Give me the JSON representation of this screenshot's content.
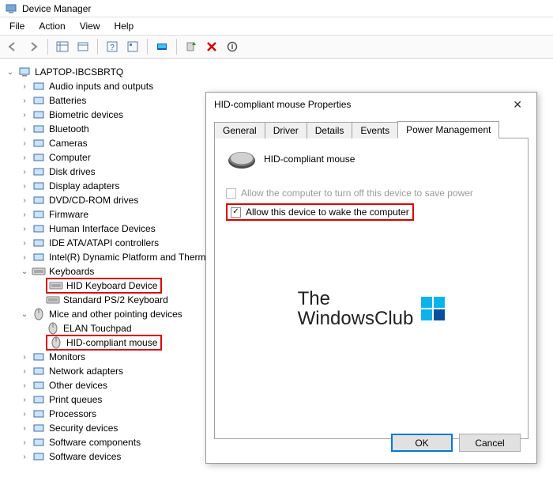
{
  "window": {
    "title": "Device Manager"
  },
  "menu": {
    "file": "File",
    "action": "Action",
    "view": "View",
    "help": "Help"
  },
  "tree": {
    "root": "LAPTOP-IBCSBRTQ",
    "items": [
      "Audio inputs and outputs",
      "Batteries",
      "Biometric devices",
      "Bluetooth",
      "Cameras",
      "Computer",
      "Disk drives",
      "Display adapters",
      "DVD/CD-ROM drives",
      "Firmware",
      "Human Interface Devices",
      "IDE ATA/ATAPI controllers",
      "Intel(R) Dynamic Platform and Thermal Framework",
      "Keyboards",
      "Mice and other pointing devices",
      "Monitors",
      "Network adapters",
      "Other devices",
      "Print queues",
      "Processors",
      "Security devices",
      "Software components",
      "Software devices"
    ],
    "keyboards_children": [
      "HID Keyboard Device",
      "Standard PS/2 Keyboard"
    ],
    "mice_children": [
      "ELAN Touchpad",
      "HID-compliant mouse"
    ]
  },
  "dialog": {
    "title": "HID-compliant mouse Properties",
    "tabs": {
      "general": "General",
      "driver": "Driver",
      "details": "Details",
      "events": "Events",
      "power": "Power Management"
    },
    "device_name": "HID-compliant mouse",
    "chk_turnoff": "Allow the computer to turn off this device to save power",
    "chk_wake": "Allow this device to wake the computer",
    "ok": "OK",
    "cancel": "Cancel"
  },
  "watermark": {
    "line1": "The",
    "line2": "WindowsClub"
  }
}
